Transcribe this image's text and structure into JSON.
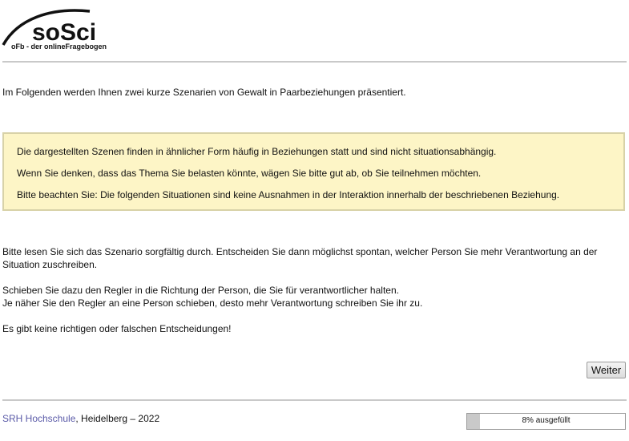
{
  "logo": {
    "brand": "soSci",
    "tagline": "oFb - der onlineFragebogen"
  },
  "intro_text": "Im Folgenden werden Ihnen zwei kurze Szenarien von Gewalt in Paarbeziehungen präsentiert.",
  "notice": {
    "lines": [
      "Die dargestellten Szenen finden in ähnlicher Form häufig in Beziehungen statt und sind nicht situationsabhängig.",
      "Wenn Sie denken, dass das Thema Sie belasten könnte, wägen Sie bitte gut ab, ob Sie teilnehmen möchten.",
      "Bitte beachten Sie: Die folgenden Situationen sind keine Ausnahmen in der Interaktion innerhalb der beschriebenen Beziehung."
    ],
    "background_color": "#fdf5c6"
  },
  "instructions": {
    "p1": "Bitte lesen Sie sich das Szenario sorgfältig durch. Entscheiden Sie dann möglichst spontan, welcher Person Sie mehr Verantwortung an der Situation zuschreiben.",
    "p2_line1": "Schieben Sie dazu den Regler in die Richtung der Person, die Sie für verantwortlicher halten.",
    "p2_line2": "Je näher Sie den Regler an eine Person schieben, desto mehr Verantwortung schreiben Sie ihr zu.",
    "p3": "Es gibt keine richtigen oder falschen Entscheidungen!"
  },
  "next_button_label": "Weiter",
  "footer": {
    "link_text": "SRH Hochschule",
    "rest_text": ", Heidelberg – 2022",
    "link_color": "#5a5aa8"
  },
  "progress": {
    "percent": 8,
    "label": "8% ausgefüllt"
  }
}
